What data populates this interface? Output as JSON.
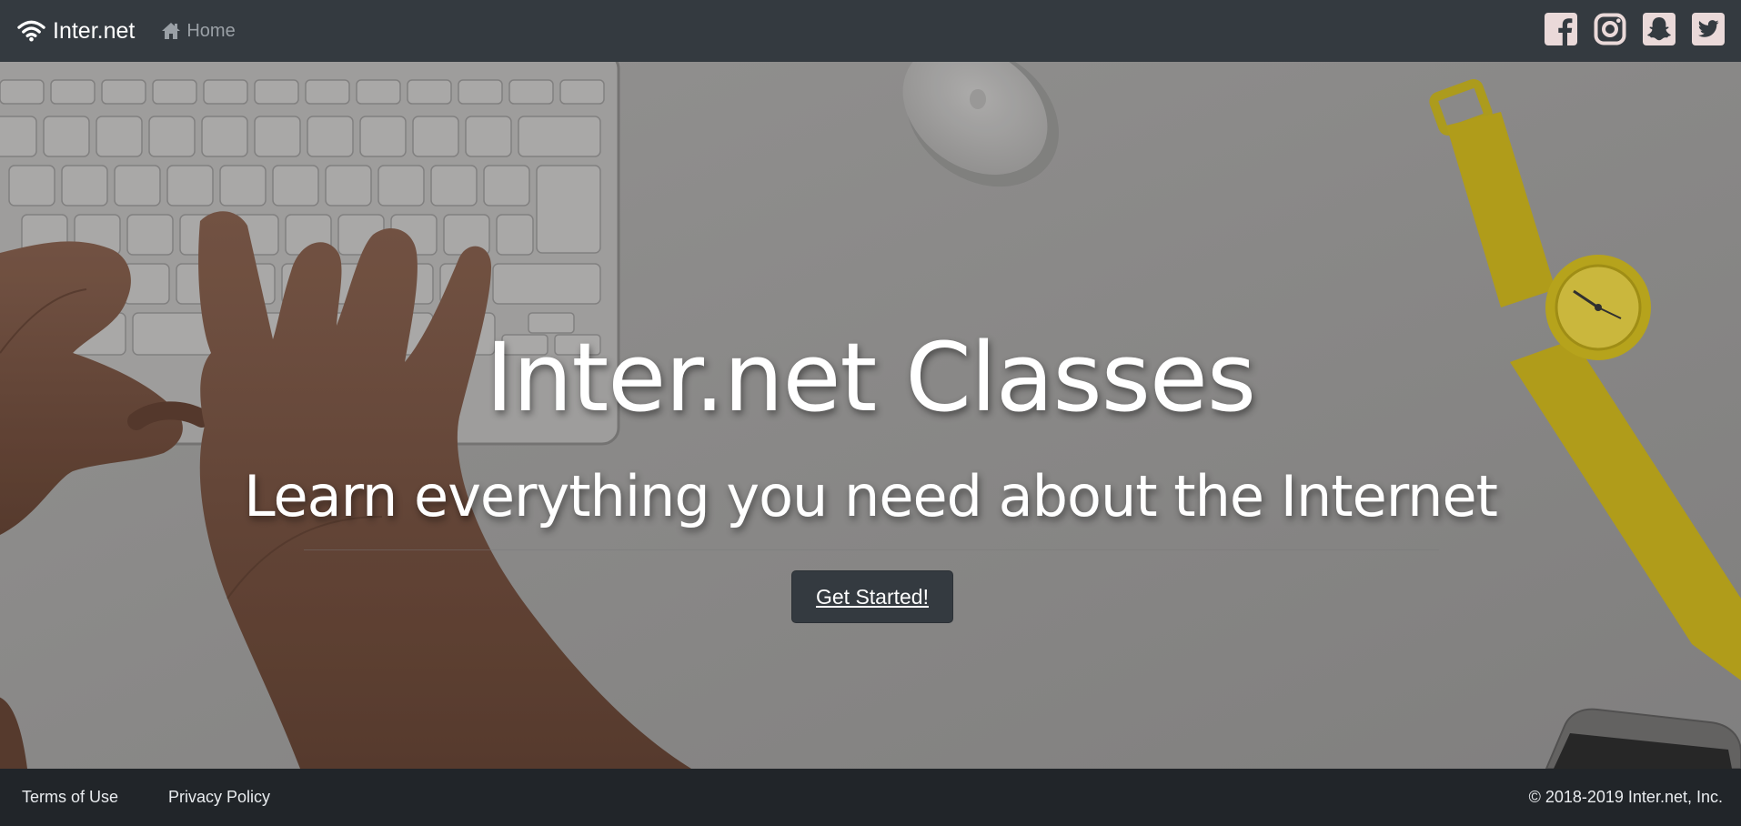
{
  "navbar": {
    "brand": "Inter.net",
    "brand_icon": "wifi-icon",
    "home_label": "Home",
    "home_icon": "home-icon",
    "social": [
      "facebook-icon",
      "instagram-icon",
      "snapchat-icon",
      "twitter-icon"
    ]
  },
  "hero": {
    "title": "Inter.net Classes",
    "subtitle": "Learn everything you need about the Internet",
    "cta_label": "Get Started!"
  },
  "footer": {
    "terms": "Terms of Use",
    "privacy": "Privacy Policy",
    "copyright": "© 2018-2019 Inter.net, Inc."
  },
  "colors": {
    "navbar_bg": "#343a40",
    "footer_bg": "#212529",
    "button_bg": "#343a40",
    "social_icon": "#ead9d9",
    "watch_yellow": "#ecd21b"
  }
}
